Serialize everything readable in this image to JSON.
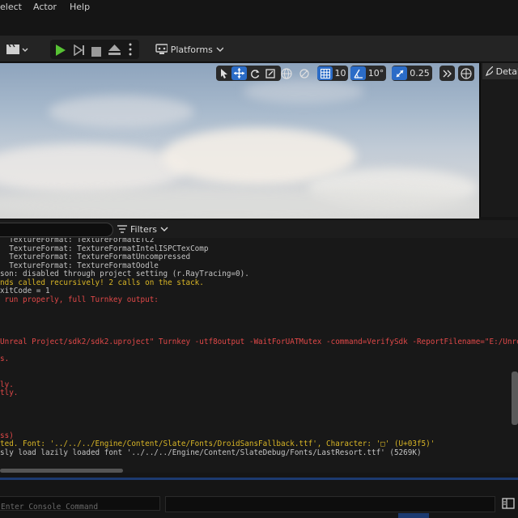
{
  "menu": {
    "items": [
      "elect",
      "Actor",
      "Help"
    ]
  },
  "toolbar": {
    "platforms_label": "Platforms"
  },
  "viewport": {
    "grid_size": "10",
    "rotation_snap": "10°",
    "scale_snap": "0.25"
  },
  "details": {
    "tab_label": "Detai"
  },
  "log": {
    "filters_label": "Filters",
    "lines": [
      {
        "text": "  TextureFormat: TextureFormatETC2",
        "color": "grey"
      },
      {
        "text": "  TextureFormat: TextureFormatIntelISPCTexComp",
        "color": "grey"
      },
      {
        "text": "  TextureFormat: TextureFormatUncompressed",
        "color": "grey"
      },
      {
        "text": "  TextureFormat: TextureFormatOodle",
        "color": "grey"
      },
      {
        "text": "son: disabled through project setting (r.RayTracing=0).",
        "color": "grey"
      },
      {
        "text": "nds called recursively! 2 calls on the stack.",
        "color": "yellow"
      },
      {
        "text": "xitCode = 1",
        "color": "grey"
      },
      {
        "text": " run properly, full Turnkey output:",
        "color": "red"
      },
      {
        "text": "",
        "color": "grey"
      },
      {
        "text": "",
        "color": "grey"
      },
      {
        "text": "",
        "color": "grey"
      },
      {
        "text": "",
        "color": "grey"
      },
      {
        "text": "Unreal Project/sdk2/sdk2.uproject\" Turnkey -utf8output -WaitForUATMutex -command=VerifySdk -ReportFilename=\"E:/Unrea",
        "color": "red"
      },
      {
        "text": "",
        "color": "grey"
      },
      {
        "text": "s.",
        "color": "red"
      },
      {
        "text": "",
        "color": "grey"
      },
      {
        "text": "",
        "color": "grey"
      },
      {
        "text": "ly.",
        "color": "red"
      },
      {
        "text": "tly.",
        "color": "red"
      },
      {
        "text": "",
        "color": "grey"
      },
      {
        "text": "",
        "color": "grey"
      },
      {
        "text": "",
        "color": "grey"
      },
      {
        "text": "",
        "color": "grey"
      },
      {
        "text": "ss)",
        "color": "red"
      },
      {
        "text": "ted. Font: '../../../Engine/Content/Slate/Fonts/DroidSansFallback.ttf', Character: '□' (U+03f5)'",
        "color": "yellow"
      },
      {
        "text": "sly load lazily loaded font '../../../Engine/Content/SlateDebug/Fonts/LastResort.ttf' (5269K)",
        "color": "grey"
      }
    ]
  },
  "console": {
    "placeholder": "Enter Console Command"
  },
  "colors": {
    "accent": "#2b6cc7",
    "play_green": "#57c234",
    "warning": "#d9b626",
    "error": "#e04848"
  }
}
